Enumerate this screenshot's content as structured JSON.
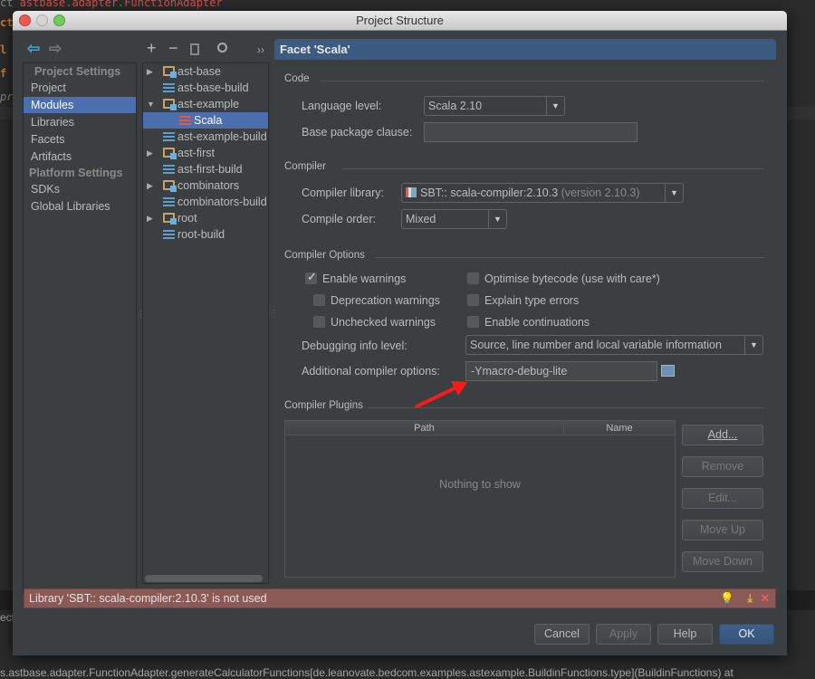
{
  "background": {
    "top_line": "astbase.adapter.FunctionAdapter",
    "gutter": [
      "ct",
      "l",
      "f",
      "pr"
    ],
    "left_bottom": "ect",
    "bottom_line": "s.astbase.adapter.FunctionAdapter.generateCalculatorFunctions[de.leanovate.bedcom.examples.astexample.BuildinFunctions.type](BuildinFunctions) at"
  },
  "window": {
    "title": "Project Structure"
  },
  "nav": {
    "project_settings_header": "Project Settings",
    "project_items": [
      "Project",
      "Modules",
      "Libraries",
      "Facets",
      "Artifacts"
    ],
    "selected": "Modules",
    "platform_settings_header": "Platform Settings",
    "platform_items": [
      "SDKs",
      "Global Libraries"
    ]
  },
  "toolbar": {
    "add": "+",
    "remove": "−",
    "more": "››"
  },
  "tree": [
    {
      "label": "ast-base",
      "type": "module",
      "expander": "collapsed"
    },
    {
      "label": "ast-base-build",
      "type": "build"
    },
    {
      "label": "ast-example",
      "type": "module",
      "expander": "expanded"
    },
    {
      "label": "Scala",
      "type": "facet",
      "selected": true
    },
    {
      "label": "ast-example-build",
      "type": "build"
    },
    {
      "label": "ast-first",
      "type": "module",
      "expander": "collapsed"
    },
    {
      "label": "ast-first-build",
      "type": "build"
    },
    {
      "label": "combinators",
      "type": "module",
      "expander": "collapsed"
    },
    {
      "label": "combinators-build",
      "type": "build"
    },
    {
      "label": "root",
      "type": "module",
      "expander": "collapsed"
    },
    {
      "label": "root-build",
      "type": "build"
    }
  ],
  "facet": {
    "header": "Facet 'Scala'",
    "code_section": "Code",
    "language_level_label": "Language level:",
    "language_level_value": "Scala 2.10",
    "base_package_label": "Base package clause:",
    "base_package_value": "",
    "compiler_section": "Compiler",
    "compiler_library_label": "Compiler library:",
    "compiler_library_value": "SBT:: scala-compiler:2.10.3",
    "compiler_library_version": "(version 2.10.3)",
    "compile_order_label": "Compile order:",
    "compile_order_value": "Mixed",
    "options_section": "Compiler Options",
    "checkboxes": [
      {
        "label": "Enable warnings",
        "checked": true
      },
      {
        "label": "Deprecation warnings",
        "checked": false
      },
      {
        "label": "Unchecked warnings",
        "checked": false
      },
      {
        "label": "Optimise bytecode (use with care*)",
        "checked": false
      },
      {
        "label": "Explain type errors",
        "checked": false
      },
      {
        "label": "Enable continuations",
        "checked": false
      }
    ],
    "debug_level_label": "Debugging info level:",
    "debug_level_value": "Source, line number and local variable information",
    "additional_options_label": "Additional compiler options:",
    "additional_options_value": "-Ymacro-debug-lite",
    "plugins_section": "Compiler Plugins",
    "plugins_columns": [
      "Path",
      "Name"
    ],
    "plugins_empty": "Nothing to show",
    "plugin_buttons": [
      "Add...",
      "Remove",
      "Edit...",
      "Move Up",
      "Move Down"
    ]
  },
  "error_bar": {
    "message": "Library 'SBT:: scala-compiler:2.10.3' is not used",
    "color": "#8b5a57"
  },
  "buttons": {
    "cancel": "Cancel",
    "apply": "Apply",
    "help": "Help",
    "ok": "OK"
  },
  "colors": {
    "selection": "#4b6eaf",
    "annotation_arrow": "#ff0000"
  }
}
